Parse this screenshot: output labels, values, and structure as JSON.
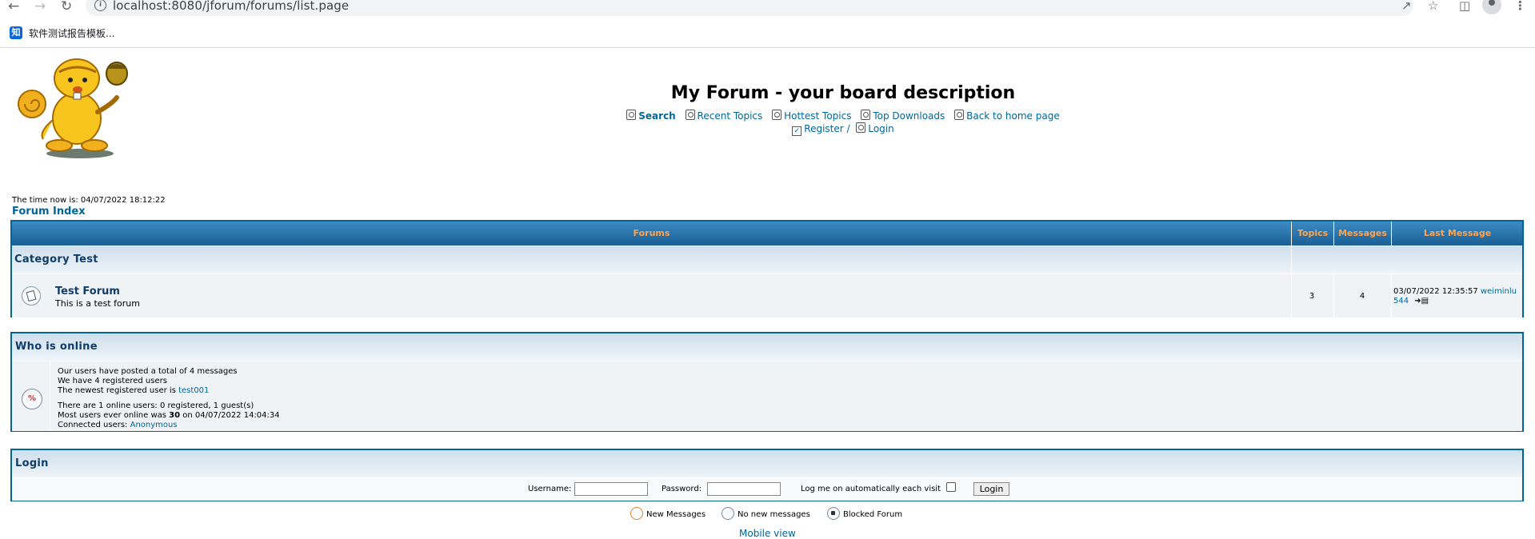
{
  "browser": {
    "url": "localhost:8080/jforum/forums/list.page",
    "bookmark_icon": "知",
    "bookmark_label": "软件测试报告模板..."
  },
  "header": {
    "title": "My Forum - your board description",
    "links": {
      "search": "Search",
      "recent": "Recent Topics",
      "hottest": "Hottest Topics",
      "downloads": "Top Downloads",
      "home": "Back to home page",
      "register": "Register /",
      "login": "Login"
    },
    "time_now": "The time now is: 04/07/2022 18:12:22",
    "forum_index": "Forum Index"
  },
  "forums_table": {
    "headers": {
      "forums": "Forums",
      "topics": "Topics",
      "messages": "Messages",
      "last_message": "Last Message"
    },
    "category": "Category Test",
    "forum": {
      "name": "Test Forum",
      "description": "This is a test forum",
      "topics": "3",
      "messages": "4",
      "last_date": "03/07/2022 12:35:57",
      "last_user_a": "weiminlu",
      "last_user_b": "544"
    }
  },
  "who_is_online": {
    "title": "Who is online",
    "line1": "Our users have posted a total of 4 messages",
    "line2": "We have 4 registered users",
    "line3_prefix": "The newest registered user is",
    "newest_user": "test001",
    "line4": "There are 1 online users: 0 registered, 1 guest(s)",
    "line5_prefix": "Most users ever online was",
    "max_users": "30",
    "line5_suffix": "on 04/07/2022 14:04:34",
    "connected_prefix": "Connected users:",
    "connected_user": "Anonymous"
  },
  "login_box": {
    "title": "Login",
    "username_label": "Username:",
    "password_label": "Password:",
    "auto_label": "Log me on automatically each visit",
    "button": "Login"
  },
  "legend": {
    "new": "New Messages",
    "none": "No new messages",
    "blocked": "Blocked Forum"
  },
  "mobile_view": "Mobile view"
}
